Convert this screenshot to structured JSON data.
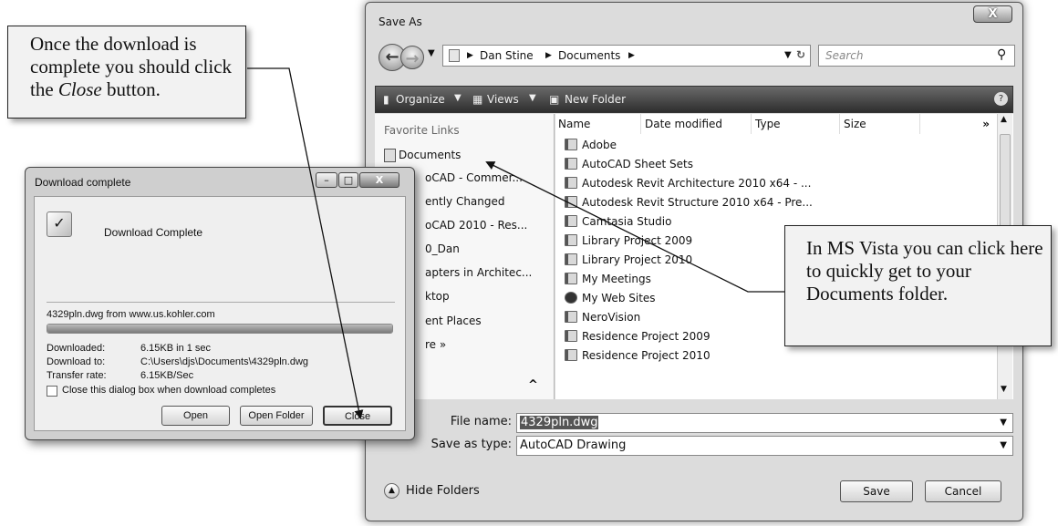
{
  "callouts": {
    "close": {
      "pre": "Once the download is complete you should click the ",
      "em": "Close",
      "post": " button."
    },
    "vista": {
      "text": "In MS Vista you can click here to quickly get to your Documents folder."
    }
  },
  "save_as": {
    "title": "Save As",
    "close_glyph": "X",
    "breadcrumb": [
      "Dan Stine",
      "Documents"
    ],
    "search_placeholder": "Search",
    "toolbar": {
      "organize": "Organize",
      "views": "Views",
      "new_folder": "New Folder",
      "help": "?"
    },
    "favorite_links_header": "Favorite Links",
    "favorite_links": [
      "Documents",
      "oCAD - Commer...",
      "ently Changed",
      "oCAD 2010 - Res...",
      "0_Dan",
      "apters in Architec...",
      "ktop",
      "ent Places",
      "re »"
    ],
    "columns": [
      "Name",
      "Date modified",
      "Type",
      "Size",
      "»"
    ],
    "files": [
      "Adobe",
      "AutoCAD Sheet Sets",
      "Autodesk Revit Architecture 2010 x64 - ...",
      "Autodesk Revit Structure 2010 x64 - Pre...",
      "Camtasia Studio",
      "Library Project 2009",
      "Library Project 2010",
      "My Meetings",
      "My Web Sites",
      "NeroVision",
      "Residence Project 2009",
      "Residence Project 2010"
    ],
    "file_name_label": "File name:",
    "file_name_value": "4329pln.dwg",
    "save_type_label": "Save as type:",
    "save_type_value": "AutoCAD Drawing",
    "hide_folders": "Hide Folders",
    "save_button": "Save",
    "cancel_button": "Cancel"
  },
  "download": {
    "title": "Download complete",
    "heading": "Download Complete",
    "file_source": "4329pln.dwg from www.us.kohler.com",
    "progress_fraction": 1.0,
    "downloaded_label": "Downloaded:",
    "downloaded_value": "6.15KB in 1 sec",
    "download_to_label": "Download to:",
    "download_to_value": "C:\\Users\\djs\\Documents\\4329pln.dwg",
    "transfer_rate_label": "Transfer rate:",
    "transfer_rate_value": "6.15KB/Sec",
    "checkbox_label": "Close this dialog box when download completes",
    "open_button": "Open",
    "open_folder_button": "Open Folder",
    "close_button": "Close"
  }
}
